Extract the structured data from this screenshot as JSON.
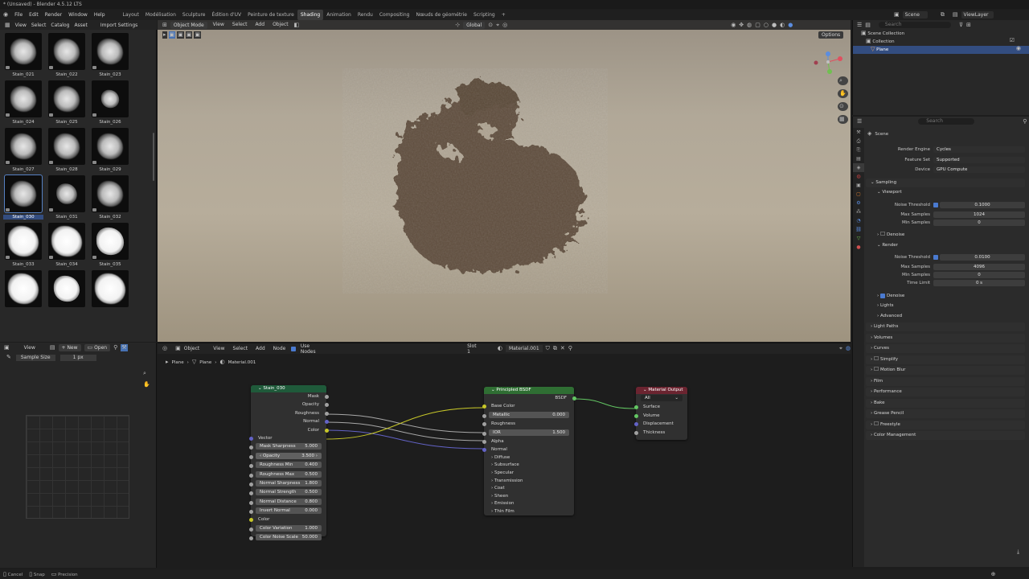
{
  "title": "* (Unsaved) - Blender 4.5.12 LTS",
  "menu": [
    "File",
    "Edit",
    "Render",
    "Window",
    "Help"
  ],
  "workspaces": [
    "Layout",
    "Modélisation",
    "Sculpture",
    "Édition d'UV",
    "Peinture de texture",
    "Shading",
    "Animation",
    "Rendu",
    "Compositing",
    "Nœuds de géométrie",
    "Scripting"
  ],
  "active_workspace": "Shading",
  "scene": "Scene",
  "viewlayer": "ViewLayer",
  "asset_browser": {
    "header": [
      "View",
      "Select",
      "Catalog",
      "Asset",
      "Import Settings"
    ],
    "assets": [
      "Stain_021",
      "Stain_022",
      "Stain_023",
      "Stain_024",
      "Stain_025",
      "Stain_026",
      "Stain_027",
      "Stain_028",
      "Stain_029",
      "Stain_030",
      "Stain_031",
      "Stain_032",
      "Stain_033",
      "Stain_034",
      "Stain_035"
    ],
    "selected": "Stain_030"
  },
  "viewport": {
    "mode": "Object Mode",
    "menus": [
      "View",
      "Select",
      "Add",
      "Object"
    ],
    "orientation": "Global",
    "options": "Options"
  },
  "outliner": {
    "search": "Search",
    "items": [
      "Scene Collection",
      "Collection",
      "Plane"
    ]
  },
  "properties": {
    "search": "Search",
    "context": "Scene",
    "render_engine_label": "Render Engine",
    "render_engine": "Cycles",
    "feature_set_label": "Feature Set",
    "feature_set": "Supported",
    "device_label": "Device",
    "device": "GPU Compute",
    "sampling": "Sampling",
    "viewport": "Viewport",
    "noise_threshold_label": "Noise Threshold",
    "vp_noise": "0.1000",
    "max_samples_label": "Max Samples",
    "vp_max": "1024",
    "min_samples_label": "Min Samples",
    "vp_min": "0",
    "denoise": "Denoise",
    "render": "Render",
    "r_noise": "0.0100",
    "r_max": "4096",
    "r_min": "0",
    "time_limit_label": "Time Limit",
    "r_time": "0 s",
    "lights": "Lights",
    "advanced": "Advanced",
    "panels": [
      "Light Paths",
      "Volumes",
      "Curves",
      "Simplify",
      "Motion Blur",
      "Film",
      "Performance",
      "Bake",
      "Grease Pencil",
      "Freestyle",
      "Color Management"
    ]
  },
  "image_editor": {
    "view": "View",
    "new": "New",
    "open": "Open",
    "sample_size_label": "Sample Size",
    "sample_size": "1 px"
  },
  "node_editor": {
    "type": "Object",
    "menus": [
      "View",
      "Select",
      "Add",
      "Node"
    ],
    "use_nodes": "Use Nodes",
    "slot": "Slot 1",
    "material": "Material.001",
    "breadcrumb": [
      "Plane",
      "Plane",
      "Material.001"
    ],
    "stain_node": {
      "title": "Stain_030",
      "outputs": [
        "Mask",
        "Opacity",
        "Roughness",
        "Normal",
        "Color"
      ],
      "vector": "Vector",
      "fields": [
        {
          "label": "Mask Sharpness",
          "value": "5.000"
        },
        {
          "label": "Opacity",
          "value": "3.500"
        },
        {
          "label": "Roughness Min",
          "value": "0.400"
        },
        {
          "label": "Roughness Max",
          "value": "0.500"
        },
        {
          "label": "Normal Sharpness",
          "value": "1.800"
        },
        {
          "label": "Normal Strength",
          "value": "0.500"
        },
        {
          "label": "Normal Distance",
          "value": "0.800"
        },
        {
          "label": "Invert Normal",
          "value": "0.000"
        }
      ],
      "color": "Color",
      "fields2": [
        {
          "label": "Color Variation",
          "value": "1.000"
        },
        {
          "label": "Color Noise Scale",
          "value": "50.000"
        }
      ]
    },
    "bsdf_node": {
      "title": "Principled BSDF",
      "output": "BSDF",
      "base_color": "Base Color",
      "metallic_label": "Metallic",
      "metallic": "0.000",
      "roughness": "Roughness",
      "ior_label": "IOR",
      "ior": "1.500",
      "alpha": "Alpha",
      "normal": "Normal",
      "panels": [
        "Diffuse",
        "Subsurface",
        "Specular",
        "Transmission",
        "Coat",
        "Sheen",
        "Emission",
        "Thin Film"
      ]
    },
    "output_node": {
      "title": "Material Output",
      "target": "All",
      "inputs": [
        "Surface",
        "Volume",
        "Displacement",
        "Thickness"
      ]
    }
  },
  "statusbar": [
    "Cancel",
    "Snap",
    "Precision"
  ]
}
